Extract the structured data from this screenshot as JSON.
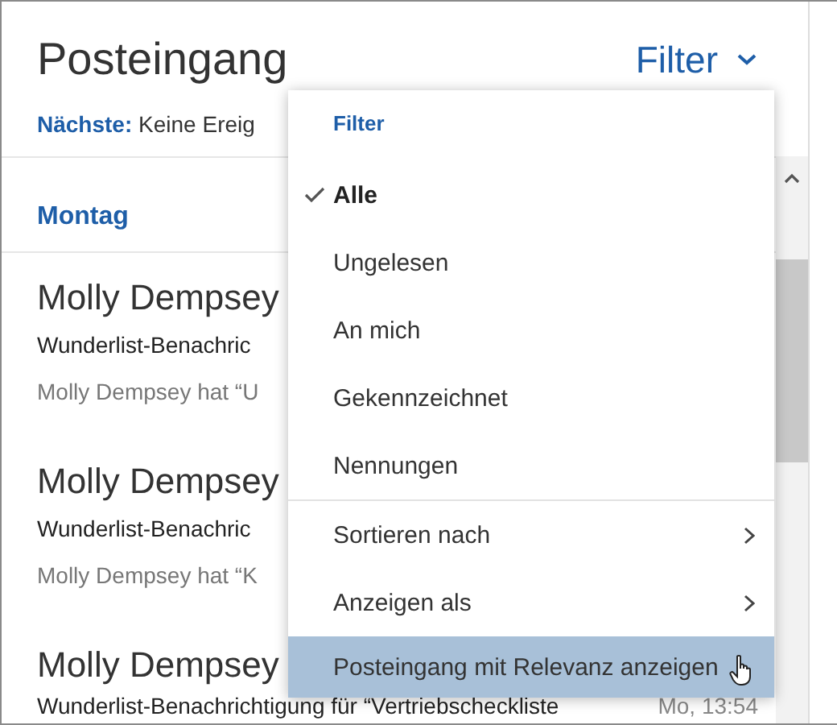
{
  "header": {
    "title": "Posteingang",
    "filter_button": "Filter",
    "next_label": "Nächste:",
    "next_text": "Keine Ereig"
  },
  "day_heading": "Montag",
  "messages": [
    {
      "sender": "Molly Dempsey",
      "subject": "Wunderlist-Benachric",
      "preview": "Molly Dempsey hat “U"
    },
    {
      "sender": "Molly Dempsey",
      "subject": "Wunderlist-Benachric",
      "preview": "Molly Dempsey hat “K"
    },
    {
      "sender": "Molly Dempsey",
      "subject": "Wunderlist-Benachrichtigung für “Vertriebscheckliste",
      "time": "Mo, 13:54"
    }
  ],
  "filter_menu": {
    "heading": "Filter",
    "items": [
      {
        "kind": "filter",
        "label": "Alle",
        "checked": true,
        "highlighted": false
      },
      {
        "kind": "filter",
        "label": "Ungelesen",
        "checked": false,
        "highlighted": false
      },
      {
        "kind": "filter",
        "label": "An mich",
        "checked": false,
        "highlighted": false
      },
      {
        "kind": "filter",
        "label": "Gekennzeichnet",
        "checked": false,
        "highlighted": false
      },
      {
        "kind": "filter",
        "label": "Nennungen",
        "checked": false,
        "highlighted": false
      },
      {
        "kind": "submenu",
        "label": "Sortieren nach",
        "highlighted": false
      },
      {
        "kind": "submenu",
        "label": "Anzeigen als",
        "highlighted": false
      },
      {
        "kind": "action",
        "label": "Posteingang mit Relevanz anzeigen",
        "highlighted": true
      }
    ]
  }
}
